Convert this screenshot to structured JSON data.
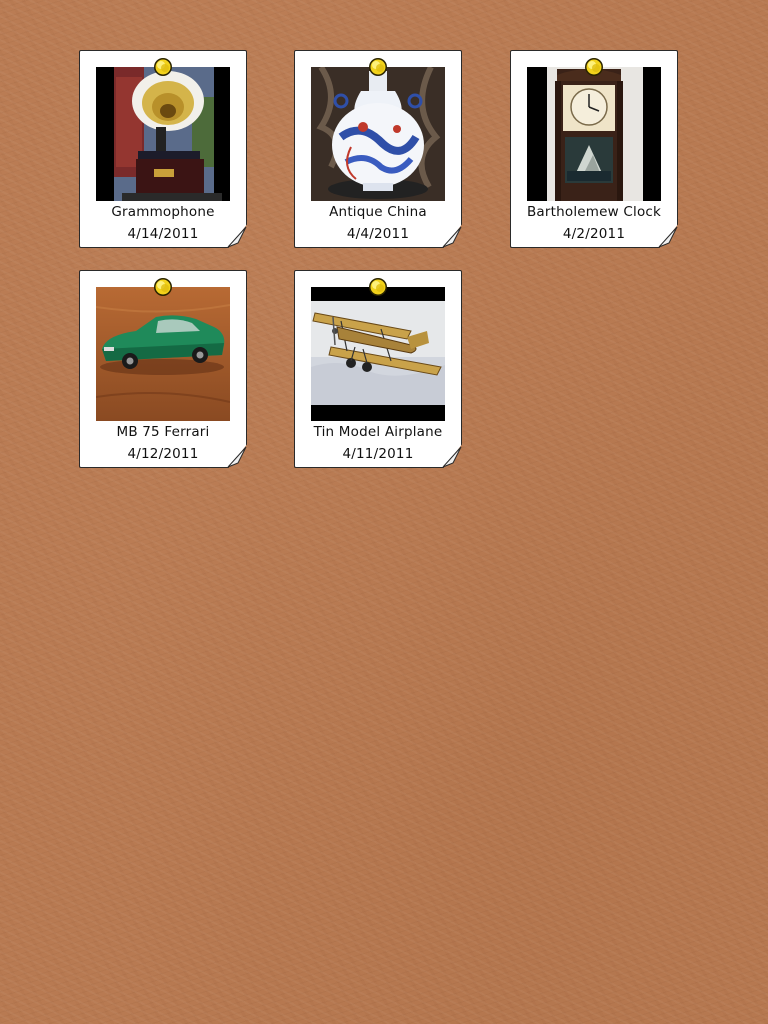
{
  "board": {
    "background": "cork",
    "accent_color": "#f2d21b"
  },
  "items": [
    {
      "title": "Grammophone",
      "date": "4/14/2011",
      "photo_icon": "gramophone-photo"
    },
    {
      "title": "Antique China",
      "date": "4/4/2011",
      "photo_icon": "china-vase-photo"
    },
    {
      "title": "Bartholemew Clock",
      "date": "4/2/2011",
      "photo_icon": "clock-photo"
    },
    {
      "title": "MB 75 Ferrari",
      "date": "4/12/2011",
      "photo_icon": "toy-car-photo"
    },
    {
      "title": "Tin Model Airplane",
      "date": "4/11/2011",
      "photo_icon": "biplane-photo"
    }
  ]
}
